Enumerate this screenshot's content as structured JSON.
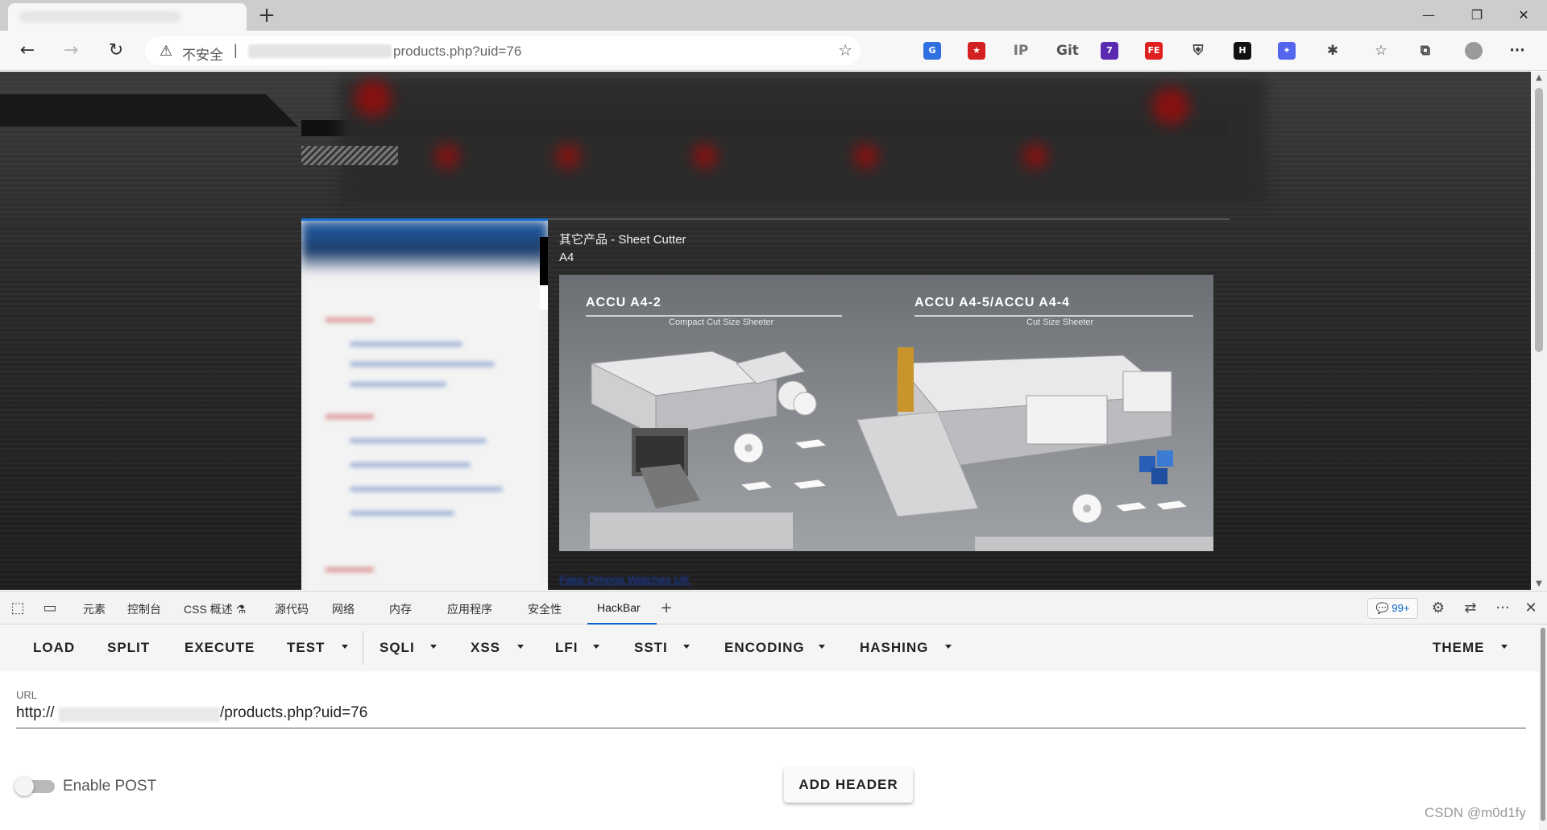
{
  "browser": {
    "new_tab": "+",
    "window_controls": {
      "minimize": "—",
      "restore": "❐",
      "close": "✕"
    },
    "nav": {
      "back": "←",
      "forward": "→",
      "reload": "↻"
    },
    "address": {
      "security_icon": "⚠",
      "security_label": "不安全",
      "separator": "|",
      "url_visible": "products.php?uid=76"
    },
    "favorite_icon": "☆",
    "extensions": [
      {
        "name": "translate",
        "glyph": "G",
        "color": "#2f6fe0"
      },
      {
        "name": "flag",
        "glyph": "★",
        "color": "#d32020"
      },
      {
        "name": "ip",
        "glyph": "IP",
        "color": "#777777"
      },
      {
        "name": "git-zip",
        "glyph": "Git",
        "color": "#555555"
      },
      {
        "name": "purple",
        "glyph": "7",
        "color": "#5a2bb0"
      },
      {
        "name": "fe",
        "glyph": "FE",
        "color": "#e02020"
      },
      {
        "name": "shield",
        "glyph": "⛨",
        "color": "#444444"
      },
      {
        "name": "hackbar-h",
        "glyph": "H",
        "color": "#111111"
      },
      {
        "name": "star-blue",
        "glyph": "✦",
        "color": "#5566ee"
      },
      {
        "name": "puzzle",
        "glyph": "✱",
        "color": "#444444"
      },
      {
        "name": "favorites",
        "glyph": "☆",
        "color": "#444444"
      },
      {
        "name": "collections",
        "glyph": "⧉",
        "color": "#444444"
      },
      {
        "name": "profile",
        "glyph": "●",
        "color": "#9a9a9a"
      },
      {
        "name": "more",
        "glyph": "···",
        "color": "#333333"
      }
    ]
  },
  "page": {
    "product_title_line1": "其它产品 - Sheet Cutter",
    "product_title_line2": "A4",
    "image": {
      "left_model": "ACCU A4-2",
      "left_subtitle": "Compact Cut Size Sheeter",
      "right_model": "ACCU A4-5/ACCU A4-4",
      "right_subtitle": "Cut Size Sheeter"
    },
    "footer_link": "Fake Omega Watches UK"
  },
  "devtools": {
    "tabs": [
      "元素",
      "控制台",
      "CSS 概述 ⚗",
      "源代码",
      "网络",
      "内存",
      "应用程序",
      "安全性",
      "HackBar"
    ],
    "active_tab": "HackBar",
    "add_tab": "+",
    "issues_badge": "💬 99+",
    "icons": {
      "inspect": "⬚",
      "device": "▭",
      "settings": "⚙",
      "dock": "⇄",
      "more": "···",
      "close": "✕"
    }
  },
  "hackbar": {
    "toolbar": [
      "LOAD",
      "SPLIT",
      "EXECUTE",
      "TEST",
      "SQLI",
      "XSS",
      "LFI",
      "SSTI",
      "ENCODING",
      "HASHING",
      "THEME"
    ],
    "url_label": "URL",
    "url_prefix": "http://",
    "url_suffix": "/products.php?uid=76",
    "enable_post_label": "Enable POST",
    "enable_post": false,
    "add_header_label": "ADD HEADER"
  },
  "watermark": "CSDN @m0d1fy"
}
